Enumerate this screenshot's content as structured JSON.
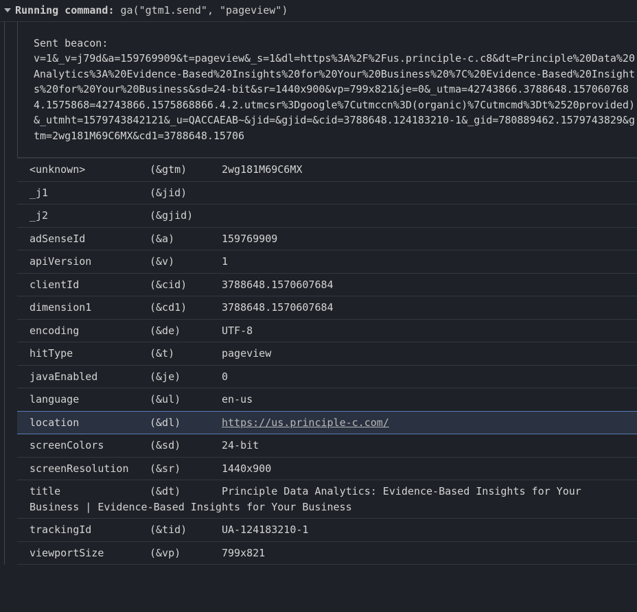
{
  "header": {
    "label": "Running command:",
    "func": "ga(\"gtm1.send\", \"pageview\")"
  },
  "beacon": {
    "label": "Sent beacon:",
    "text": "v=1&_v=j79d&a=159769909&t=pageview&_s=1&dl=https%3A%2F%2Fus.principle-c.c8&dt=Principle%20Data%20Analytics%3A%20Evidence-Based%20Insights%20for%20Your%20Business%20%7C%20Evidence-Based%20Insights%20for%20Your%20Business&sd=24-bit&sr=1440x900&vp=799x821&je=0&_utma=42743866.3788648.1570607684.1575868=42743866.1575868866.4.2.utmcsr%3Dgoogle%7Cutmccn%3D(organic)%7Cutmcmd%3Dt%2520provided)&_utmht=1579743842121&_u=QACCAEAB~&jid=&gjid=&cid=3788648.124183210-1&_gid=780889462.1579743829&gtm=2wg181M69C6MX&cd1=3788648.15706"
  },
  "params": [
    {
      "name": "<unknown>",
      "code": "(&gtm)",
      "value": "2wg181M69C6MX",
      "link": false
    },
    {
      "name": "_j1",
      "code": "(&jid)",
      "value": "",
      "link": false
    },
    {
      "name": "_j2",
      "code": "(&gjid)",
      "value": "",
      "link": false
    },
    {
      "name": "adSenseId",
      "code": "(&a)",
      "value": "159769909",
      "link": false
    },
    {
      "name": "apiVersion",
      "code": "(&v)",
      "value": "1",
      "link": false
    },
    {
      "name": "clientId",
      "code": "(&cid)",
      "value": "3788648.1570607684",
      "link": false
    },
    {
      "name": "dimension1",
      "code": "(&cd1)",
      "value": "3788648.1570607684",
      "link": false
    },
    {
      "name": "encoding",
      "code": "(&de)",
      "value": "UTF-8",
      "link": false
    },
    {
      "name": "hitType",
      "code": "(&t)",
      "value": "pageview",
      "link": false
    },
    {
      "name": "javaEnabled",
      "code": "(&je)",
      "value": "0",
      "link": false
    },
    {
      "name": "language",
      "code": "(&ul)",
      "value": "en-us",
      "link": false
    },
    {
      "name": "location",
      "code": "(&dl)",
      "value": "https://us.principle-c.com/",
      "link": true,
      "highlighted": true
    },
    {
      "name": "screenColors",
      "code": "(&sd)",
      "value": "24-bit",
      "link": false
    },
    {
      "name": "screenResolution",
      "code": "(&sr)",
      "value": "1440x900",
      "link": false
    },
    {
      "name": "title",
      "code": "(&dt)",
      "value": "Principle Data Analytics: Evidence-Based Insights for Your Business | Evidence-Based Insights for Your Business",
      "link": false,
      "wrap": true
    },
    {
      "name": "trackingId",
      "code": "(&tid)",
      "value": "UA-124183210-1",
      "link": false
    },
    {
      "name": "viewportSize",
      "code": "(&vp)",
      "value": "799x821",
      "link": false
    }
  ]
}
